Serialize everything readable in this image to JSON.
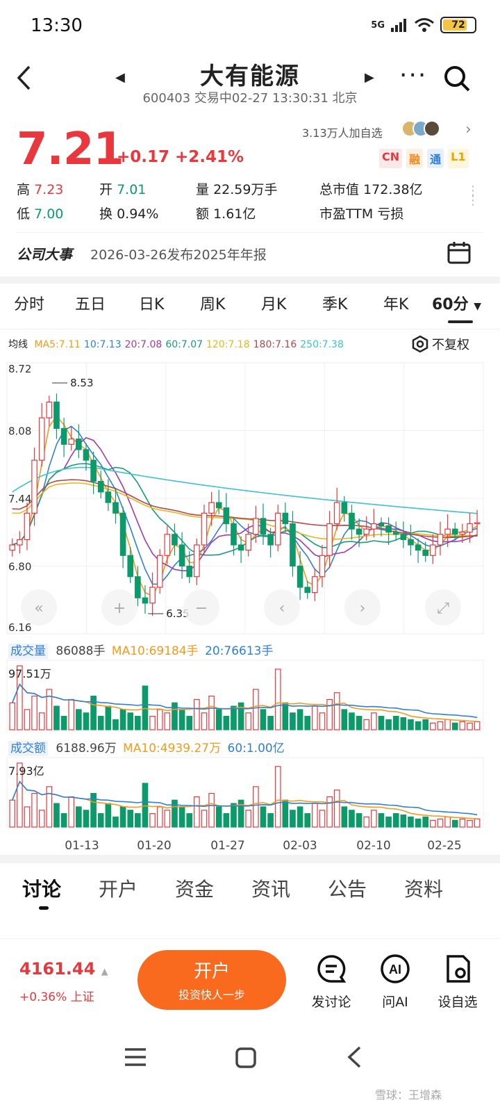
{
  "status": {
    "time": "13:30",
    "network": "5G",
    "battery": "72"
  },
  "header": {
    "title": "大有能源",
    "subtitle": "600403 交易中02-27 13:30:31 北京"
  },
  "quote": {
    "price": "7.21",
    "change": "+0.17 +2.41%",
    "followers": "3.13万人加自选",
    "tags": [
      "CN",
      "融",
      "通",
      "L1"
    ],
    "high_label": "高",
    "high": "7.23",
    "open_label": "开",
    "open": "7.01",
    "volume_label": "量",
    "volume": "22.59万手",
    "mktcap_label": "总市值",
    "mktcap": "172.38亿",
    "low_label": "低",
    "low": "7.00",
    "turnover_label": "换",
    "turnover": "0.94%",
    "amount_label": "额",
    "amount": "1.61亿",
    "pe_label": "市盈TTM",
    "pe": "亏损"
  },
  "events": {
    "label": "公司大事",
    "text": "2026-03-26发布2025年年报"
  },
  "kline_tabs": [
    "分时",
    "五日",
    "日K",
    "周K",
    "月K",
    "季K",
    "年K",
    "60分"
  ],
  "ma_legend": {
    "label": "均线",
    "items": [
      {
        "text": "MA5:7.11",
        "color": "#f29b1d"
      },
      {
        "text": "10:7.13",
        "color": "#2f7fd6"
      },
      {
        "text": "20:7.08",
        "color": "#a23aa6"
      },
      {
        "text": "60:7.07",
        "color": "#1a9a7a"
      },
      {
        "text": "120:7.18",
        "color": "#e4b820"
      },
      {
        "text": "180:7.16",
        "color": "#b3474a"
      },
      {
        "text": "250:7.38",
        "color": "#3bc3d0"
      }
    ],
    "adjust": "不复权"
  },
  "chart_data": [
    {
      "type": "candlestick",
      "ylim": [
        6.16,
        8.72
      ],
      "y_ticks": [
        "8.72",
        "8.08",
        "7.44",
        "6.80",
        "6.16"
      ],
      "max_label": "8.53",
      "min_label": "6.35",
      "x_ticks": [
        "01-13",
        "01-20",
        "01-27",
        "02-03",
        "02-10",
        "02-25"
      ],
      "close_series": [
        7.0,
        7.05,
        7.3,
        7.8,
        8.2,
        8.35,
        8.1,
        7.95,
        8.0,
        7.9,
        7.8,
        7.6,
        7.5,
        7.4,
        7.3,
        6.9,
        6.7,
        6.5,
        6.45,
        6.6,
        6.9,
        7.1,
        7.0,
        6.8,
        6.7,
        7.0,
        7.3,
        7.4,
        7.35,
        7.2,
        7.0,
        6.95,
        7.1,
        7.25,
        7.1,
        7.0,
        7.3,
        7.2,
        6.8,
        6.6,
        6.55,
        6.7,
        6.9,
        7.2,
        7.4,
        7.3,
        7.15,
        7.1,
        7.15,
        7.2,
        7.18,
        7.12,
        7.1,
        7.05,
        7.0,
        6.95,
        6.9,
        7.0,
        7.1,
        7.15,
        7.1,
        7.12,
        7.2,
        7.21
      ]
    },
    {
      "type": "bar",
      "title": "成交量",
      "values_text": [
        "86088手",
        "MA10:69184手",
        "20:76613手"
      ],
      "ymax_label": "97.51万",
      "values": [
        40,
        95,
        30,
        50,
        25,
        60,
        35,
        20,
        45,
        30,
        25,
        50,
        20,
        35,
        15,
        30,
        25,
        20,
        65,
        20,
        30,
        25,
        40,
        30,
        20,
        45,
        25,
        50,
        30,
        20,
        35,
        40,
        25,
        60,
        30,
        20,
        90,
        40,
        25,
        30,
        20,
        35,
        25,
        45,
        55,
        30,
        25,
        20,
        15,
        25,
        20,
        15,
        20,
        18,
        15,
        12,
        15,
        10,
        12,
        15,
        10,
        12,
        10,
        12
      ]
    },
    {
      "type": "bar",
      "title": "成交额",
      "values_text": [
        "6188.96万",
        "MA10:4939.27万",
        "60:1.00亿"
      ],
      "ymax_label": "7.93亿",
      "values": [
        40,
        95,
        30,
        50,
        25,
        60,
        35,
        20,
        45,
        30,
        25,
        50,
        20,
        35,
        15,
        30,
        25,
        20,
        65,
        20,
        30,
        25,
        40,
        30,
        20,
        45,
        25,
        50,
        30,
        20,
        35,
        40,
        25,
        60,
        30,
        20,
        90,
        40,
        25,
        30,
        20,
        35,
        25,
        45,
        55,
        30,
        25,
        20,
        15,
        25,
        20,
        15,
        20,
        18,
        15,
        12,
        15,
        10,
        12,
        15,
        10,
        12,
        10,
        12
      ]
    }
  ],
  "news_tabs": [
    "讨论",
    "开户",
    "资金",
    "资讯",
    "公告",
    "资料"
  ],
  "bottom": {
    "index_value": "4161.44",
    "index_change": "+0.36% 上证",
    "open_btn_main": "开户",
    "open_btn_sub": "投资快人一步",
    "items": [
      "发讨论",
      "问AI",
      "设自选"
    ]
  },
  "watermark": "雪球：王增森"
}
